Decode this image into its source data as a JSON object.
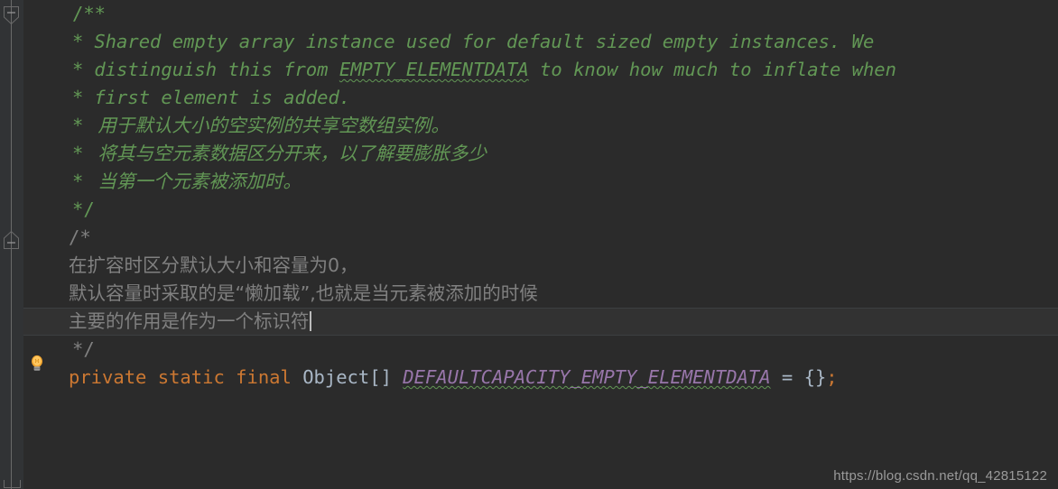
{
  "editor": {
    "background": "#2b2b2b",
    "gutter_background": "#313335",
    "current_line_background": "#323232",
    "caret_color": "#bbbbbb"
  },
  "gutter": {
    "fold_start_label": "−",
    "fold_end_label": "−",
    "bulb_name": "intention-bulb"
  },
  "colors": {
    "javadoc_comment": "#629755",
    "block_comment": "#808080",
    "keyword": "#cc7832",
    "type": "#a9b7c6",
    "static_field": "#9876aa",
    "typo_underline": "#629755"
  },
  "code": {
    "lines": [
      {
        "id": "line-1",
        "kind": "javadoc-open",
        "text": "/**"
      },
      {
        "id": "line-2",
        "kind": "javadoc",
        "marker": "*",
        "text": "Shared empty array instance used for default sized empty instances. We"
      },
      {
        "id": "line-3",
        "kind": "javadoc-typo",
        "marker": "*",
        "before": "distinguish this from ",
        "typo": "EMPTY_ELEMENTDATA",
        "after": " to know how much to inflate when"
      },
      {
        "id": "line-4",
        "kind": "javadoc",
        "marker": "*",
        "text": "first element is added."
      },
      {
        "id": "line-5",
        "kind": "javadoc-cjk",
        "marker": "*",
        "text": "用于默认大小的空实例的共享空数组实例。"
      },
      {
        "id": "line-6",
        "kind": "javadoc-cjk",
        "marker": "*",
        "text": "将其与空元素数据区分开来，以了解要膨胀多少"
      },
      {
        "id": "line-7",
        "kind": "javadoc-cjk",
        "marker": "*",
        "text": "当第一个元素被添加时。"
      },
      {
        "id": "line-8",
        "kind": "javadoc-close",
        "text": "*/"
      },
      {
        "id": "line-9",
        "kind": "block-open",
        "text": "/*"
      },
      {
        "id": "line-10",
        "kind": "block-cjk",
        "text": "在扩容时区分默认大小和容量为0，"
      },
      {
        "id": "line-11",
        "kind": "block-cjk",
        "text": "默认容量时采取的是“懒加载”,也就是当元素被添加的时候"
      },
      {
        "id": "line-12",
        "kind": "block-cjk-current",
        "text": "主要的作用是作为一个标识符",
        "has_caret": true
      },
      {
        "id": "line-13",
        "kind": "block-close",
        "text": "*/"
      },
      {
        "id": "line-14",
        "kind": "declaration",
        "keywords": "private static final ",
        "type": "Object[]",
        "space": " ",
        "field": "DEFAULTCAPACITY_EMPTY_ELEMENTDATA",
        "assign": " = ",
        "braces": "{}",
        "semicolon": ";"
      }
    ]
  },
  "watermark": {
    "text": "https://blog.csdn.net/qq_42815122"
  }
}
